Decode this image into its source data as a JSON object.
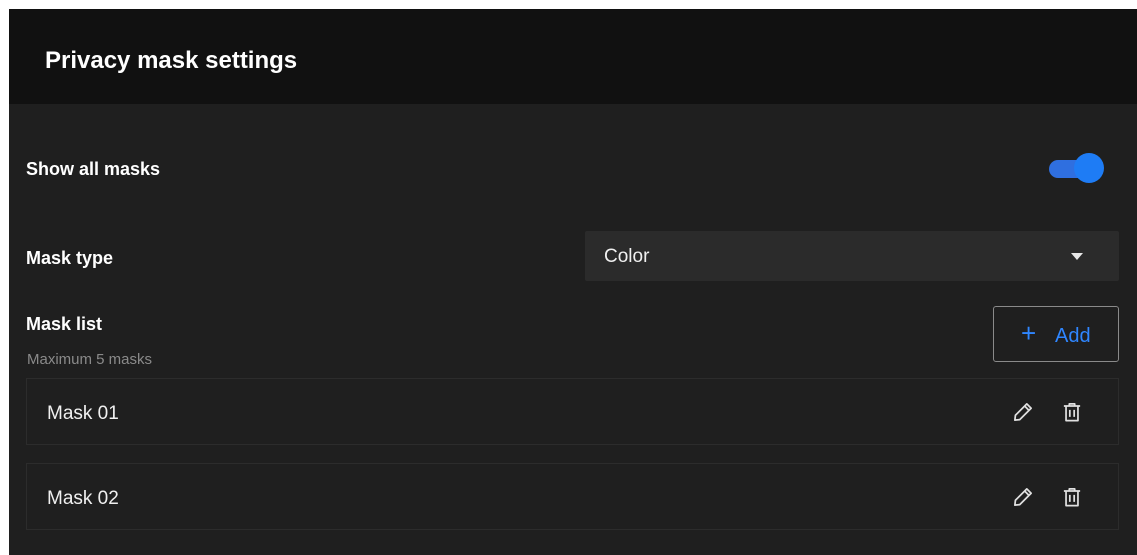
{
  "header": {
    "title": "Privacy mask settings"
  },
  "show_all_masks": {
    "label": "Show all masks",
    "enabled": true
  },
  "mask_type": {
    "label": "Mask type",
    "selected": "Color"
  },
  "mask_list": {
    "label": "Mask list",
    "hint": "Maximum 5 masks",
    "add_label": "Add",
    "items": [
      {
        "name": "Mask 01"
      },
      {
        "name": "Mask 02"
      }
    ]
  },
  "colors": {
    "panel_bg": "#1f1f1f",
    "header_bg": "#111111",
    "accent": "#2f86ff",
    "toggle_on": "#1e7cf5"
  },
  "icons": {
    "add": "plus-icon",
    "edit": "pencil-icon",
    "delete": "trash-icon",
    "dropdown": "chevron-down-icon"
  }
}
